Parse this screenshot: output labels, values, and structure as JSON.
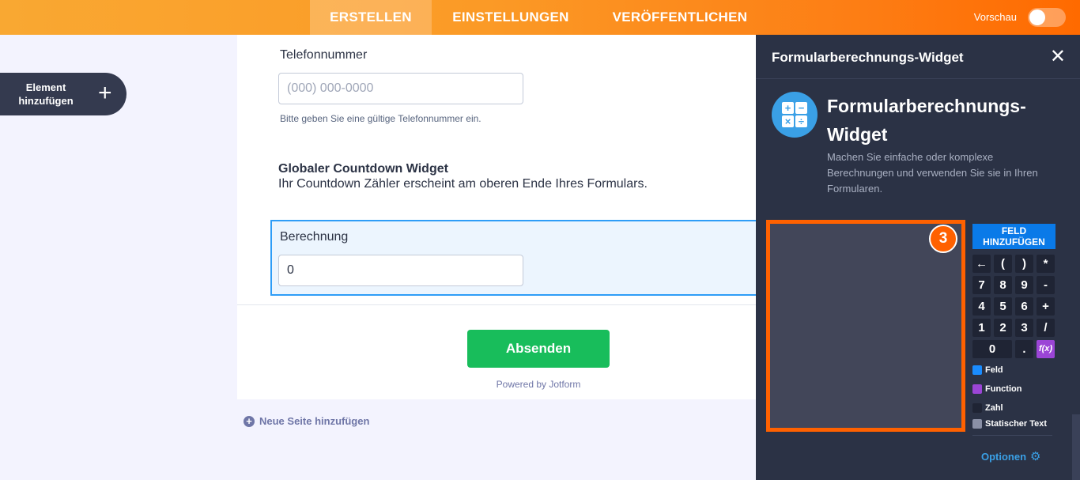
{
  "topbar": {
    "tabs": [
      {
        "label": "ERSTELLEN",
        "active": true
      },
      {
        "label": "EINSTELLUNGEN",
        "active": false
      },
      {
        "label": "VERÖFFENTLICHEN",
        "active": false
      }
    ],
    "preview_label": "Vorschau",
    "preview_on": false
  },
  "sidebar": {
    "add_element_label": "Element hinzufügen",
    "add_element_icon": "plus-icon"
  },
  "form": {
    "phone": {
      "label": "Telefonnummer",
      "placeholder": "(000) 000-0000",
      "hint": "Bitte geben Sie eine gültige Telefonnummer ein."
    },
    "countdown": {
      "title": "Globaler Countdown Widget",
      "description": "Ihr Countdown Zähler erscheint am oberen Ende Ihres Formulars."
    },
    "calculation": {
      "label": "Berechnung",
      "value": "0"
    },
    "submit_label": "Absenden",
    "powered_by": "Powered by Jotform",
    "new_page_label": "Neue Seite hinzufügen"
  },
  "panel": {
    "title": "Formularberechnungs-Widget",
    "close_icon": "close-icon",
    "widget_name": "Formularberechnungs-Widget",
    "widget_description": "Machen Sie einfache oder komplexe Berechnungen und verwenden Sie sie in Ihren Formularen.",
    "badge_number": "3",
    "add_field_label": "FELD HINZUFÜGEN",
    "keypad": [
      "←",
      "(",
      ")",
      "*",
      "7",
      "8",
      "9",
      "-",
      "4",
      "5",
      "6",
      "+",
      "1",
      "2",
      "3",
      "/",
      "0",
      ".",
      "f(x)"
    ],
    "legend": [
      {
        "label": "Feld",
        "color": "#1a8cff"
      },
      {
        "label": "Function",
        "color": "#9b45d6"
      },
      {
        "label": "Zahl",
        "color": "#1f2434"
      },
      {
        "label": "Statischer Text",
        "color": "#8a90a6"
      }
    ],
    "options_label": "Optionen",
    "options_icon": "gear-icon"
  },
  "colors": {
    "accent_orange": "#ff6100",
    "submit_green": "#18bd5b",
    "panel_bg": "#2b3245",
    "add_field_blue": "#0a7ae8"
  }
}
